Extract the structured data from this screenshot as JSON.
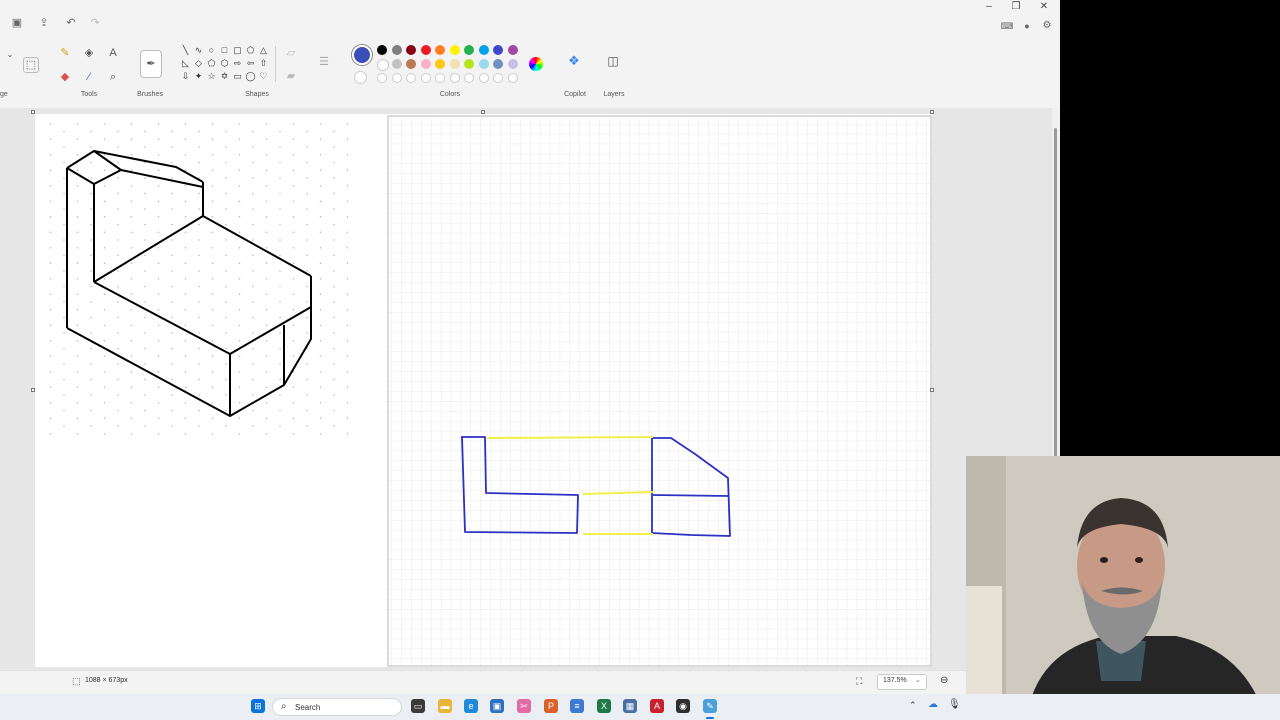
{
  "titlebar": {
    "icons": [
      "save-icon",
      "share-icon",
      "undo-icon",
      "redo-icon"
    ],
    "window_controls": [
      "minimize",
      "restore",
      "close"
    ],
    "minimize_glyph": "–",
    "restore_glyph": "❐",
    "close_glyph": "✕"
  },
  "ribbon": {
    "groups": {
      "tools": "Tools",
      "brushes": "Brushes",
      "shapes": "Shapes",
      "colors": "Colors",
      "copilot": "Copilot",
      "layers": "Layers"
    },
    "left_partial_label": "ge"
  },
  "colors": {
    "primary": "#3a4fb8",
    "row1": [
      "#000000",
      "#7f7f7f",
      "#880015",
      "#ed1c24",
      "#ff7f27",
      "#fff200",
      "#22b14c",
      "#00a2e8",
      "#3f48cc",
      "#a349a4"
    ],
    "row2": [
      "#ffffff",
      "#c3c3c3",
      "#b97a57",
      "#ffaec9",
      "#ffc90e",
      "#efe4b0",
      "#b5e61d",
      "#99d9ea",
      "#7092be",
      "#c8bfe7"
    ]
  },
  "status": {
    "canvas_size": "1088 × 673px",
    "zoom": "137.5%"
  },
  "taskbar": {
    "search_placeholder": "Search"
  },
  "drawing": {
    "ink_colors": {
      "black": "#000000",
      "blue": "#2b2fc2",
      "yellow": "#f2ee4a"
    }
  }
}
